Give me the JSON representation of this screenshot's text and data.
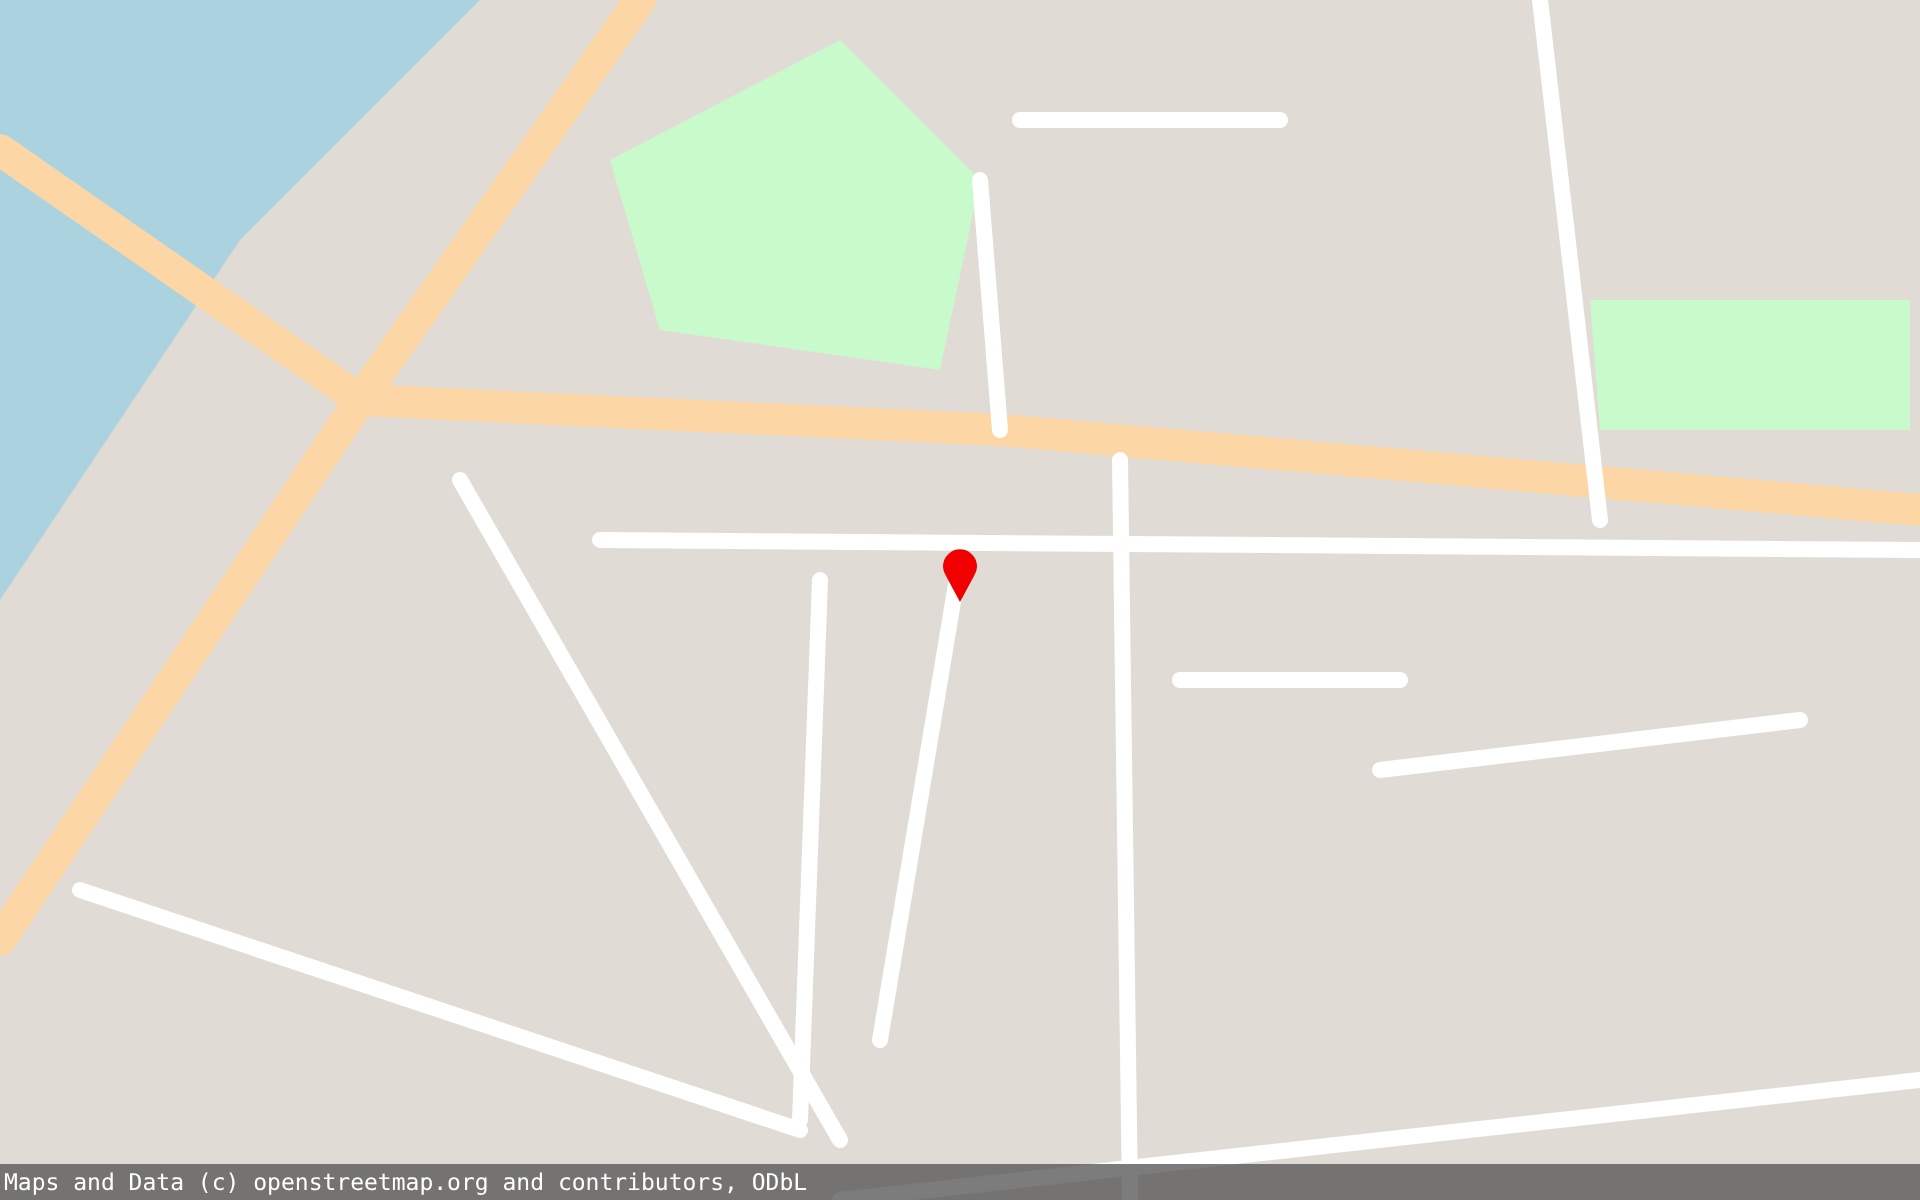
{
  "map": {
    "marker": {
      "shown": true
    }
  },
  "attribution": "Maps and Data (c) openstreetmap.org and contributors, ODbL"
}
